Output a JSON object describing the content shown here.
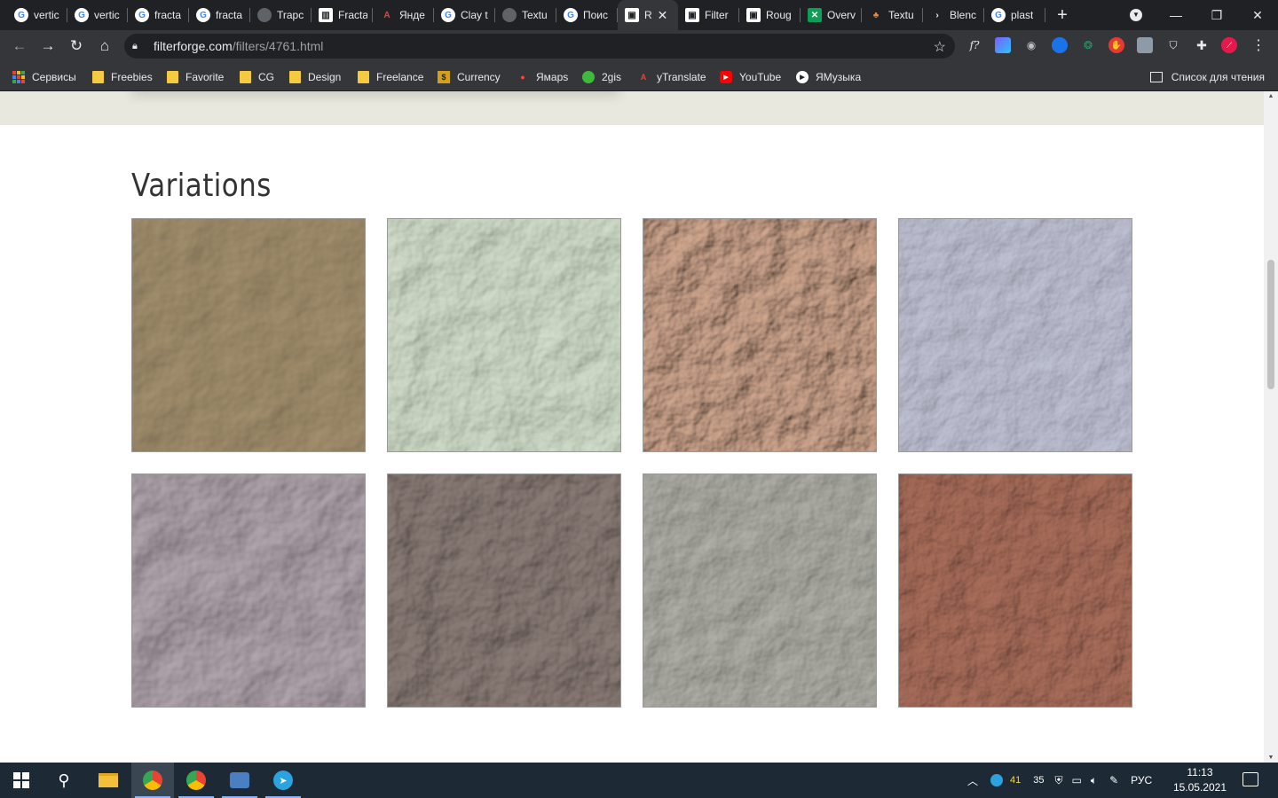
{
  "browser": {
    "tabs": [
      {
        "title": "vertic",
        "icon": "google-icon",
        "active": false
      },
      {
        "title": "vertic",
        "icon": "google-icon",
        "active": false
      },
      {
        "title": "fracta",
        "icon": "google-icon",
        "active": false
      },
      {
        "title": "fracta",
        "icon": "google-icon",
        "active": false
      },
      {
        "title": "Trapc",
        "icon": "loading-icon",
        "active": false
      },
      {
        "title": "Fracta",
        "icon": "book-icon",
        "active": false
      },
      {
        "title": "Янде",
        "icon": "yandex-translate-icon",
        "active": false
      },
      {
        "title": "Clay t",
        "icon": "google-icon",
        "active": false
      },
      {
        "title": "Textu",
        "icon": "loading-icon",
        "active": false
      },
      {
        "title": "Поис",
        "icon": "google-icon",
        "active": false
      },
      {
        "title": "R",
        "icon": "filterforge-icon",
        "active": true
      },
      {
        "title": "Filter",
        "icon": "filterforge-icon",
        "active": false
      },
      {
        "title": "Roug",
        "icon": "filterforge-icon",
        "active": false
      },
      {
        "title": "Overv",
        "icon": "envato-icon",
        "active": false
      },
      {
        "title": "Textu",
        "icon": "texture-icon",
        "active": false
      },
      {
        "title": "Blenc",
        "icon": "arrow-icon",
        "active": false
      },
      {
        "title": "plast",
        "icon": "google-icon",
        "active": false
      }
    ],
    "url_domain": "filterforge.com",
    "url_path": "/filters/4761.html",
    "bookmarks": [
      {
        "label": "Сервисы",
        "icon": "apps-icon"
      },
      {
        "label": "Freebies",
        "icon": "folder-icon"
      },
      {
        "label": "Favorite",
        "icon": "folder-icon"
      },
      {
        "label": "CG",
        "icon": "folder-icon"
      },
      {
        "label": "Design",
        "icon": "folder-icon"
      },
      {
        "label": "Freelance",
        "icon": "folder-icon"
      },
      {
        "label": "Currency",
        "icon": "currency-icon"
      },
      {
        "label": "Ямaps",
        "icon": "map-pin-icon"
      },
      {
        "label": "2gis",
        "icon": "2gis-icon"
      },
      {
        "label": "yTranslate",
        "icon": "translate-icon"
      },
      {
        "label": "YouTube",
        "icon": "youtube-icon"
      },
      {
        "label": "ЯМузыка",
        "icon": "music-icon"
      }
    ],
    "reading_list": "Список для чтения"
  },
  "page": {
    "section_title": "Variations",
    "variations": [
      {
        "name": "variation-1",
        "base": "#c6b9a1",
        "shade": "#a39780",
        "light": "#d9cdb6"
      },
      {
        "name": "variation-2",
        "base": "#d9e1d5",
        "shade": "#9aa596",
        "light": "#eef3ea"
      },
      {
        "name": "variation-3",
        "base": "#dbc2b2",
        "shade": "#b99f8d",
        "light": "#ead4c6"
      },
      {
        "name": "variation-4",
        "base": "#c9cad6",
        "shade": "#8f91a6",
        "light": "#eceef6"
      },
      {
        "name": "variation-5",
        "base": "#c6bec4",
        "shade": "#958b93",
        "light": "#e6dfe4"
      },
      {
        "name": "variation-6",
        "base": "#aaa09c",
        "shade": "#7d736f",
        "light": "#c8bfbb"
      },
      {
        "name": "variation-7",
        "base": "#c5c5c0",
        "shade": "#8f8f8a",
        "light": "#e6e6e2"
      },
      {
        "name": "variation-8",
        "base": "#c49a8c",
        "shade": "#a27869",
        "light": "#d4b0a2"
      }
    ]
  },
  "taskbar": {
    "tray_numbers": [
      "41",
      "35"
    ],
    "language": "РУС",
    "time": "11:13",
    "date": "15.05.2021"
  }
}
